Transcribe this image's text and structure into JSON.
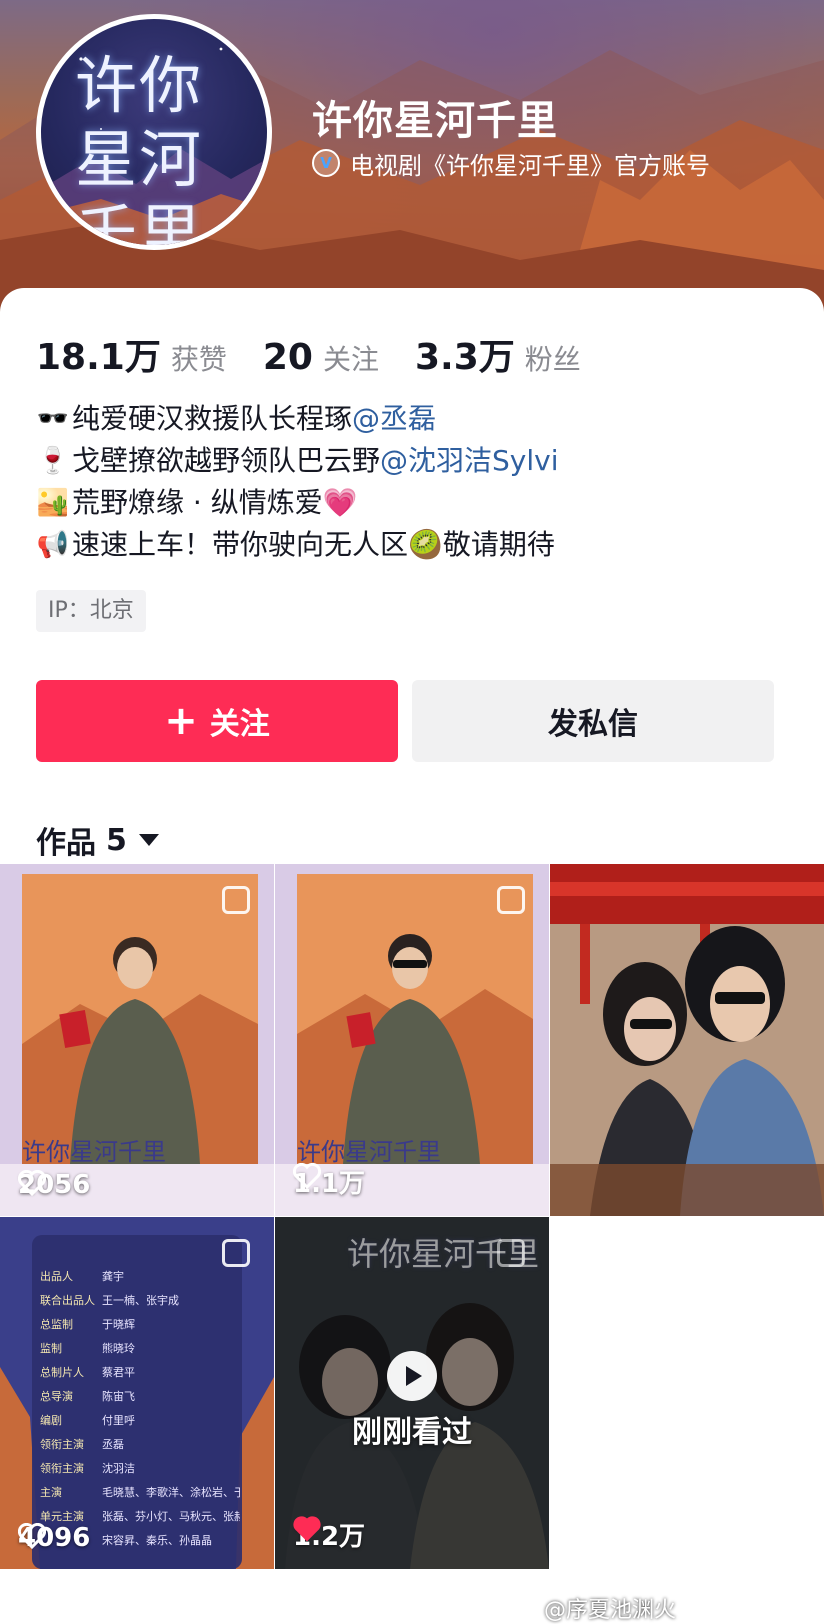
{
  "profile": {
    "name": "许你星河千里",
    "verify_text": "电视剧《许你星河千里》官方账号",
    "avatar_text": "许你星河千里",
    "stats": [
      {
        "num": "18.1万",
        "label": "获赞"
      },
      {
        "num": "20",
        "label": "关注"
      },
      {
        "num": "3.3万",
        "label": "粉丝"
      }
    ],
    "bio": [
      {
        "emoji": "🕶️",
        "text": "纯爱硬汉救援队长程琢",
        "mention": "@丞磊"
      },
      {
        "emoji": "🍷",
        "text": "戈壁撩欲越野领队巴云野",
        "mention": "@沈羽洁Sylvi"
      },
      {
        "emoji": "🏜️",
        "text": "荒野燎缘 · 纵情炼爱",
        "mention": "💗"
      },
      {
        "emoji": "📢",
        "text": "速速上车！带你驶向无人区🥝敬请期待",
        "mention": ""
      }
    ],
    "ip": "IP：北京"
  },
  "actions": {
    "follow_plus": "+",
    "follow_label": "关注",
    "message_label": "发私信"
  },
  "works": {
    "label": "作品",
    "count": "5"
  },
  "grid": [
    {
      "likes": "2056",
      "title": "许你星河千里"
    },
    {
      "likes": "1.1万",
      "title": "许你星河千里"
    },
    {
      "likes": ""
    },
    {
      "likes": "4096",
      "credits": [
        {
          "role": "出品人",
          "name": "龚宇"
        },
        {
          "role": "联合出品人",
          "name": "王一楠、张宇成"
        },
        {
          "role": "总监制",
          "name": "于晓辉"
        },
        {
          "role": "监制",
          "name": "熊晓玲"
        },
        {
          "role": "总制片人",
          "name": "蔡君平"
        },
        {
          "role": "总导演",
          "name": "陈宙飞"
        },
        {
          "role": "编剧",
          "name": "付里呼"
        },
        {
          "role": "领衔主演",
          "name": "丞磊"
        },
        {
          "role": "领衔主演",
          "name": "沈羽洁"
        },
        {
          "role": "主演",
          "name": "毛晓慧、李歌洋、涂松岩、于毅"
        },
        {
          "role": "单元主演",
          "name": "张磊、芬小灯、马秋元、张赫"
        },
        {
          "role": "",
          "name": "宋容昇、秦乐、孙晶晶"
        }
      ]
    },
    {
      "likes": "1.2万",
      "title": "许你星河千里",
      "watched": "刚刚看过"
    }
  ],
  "watermark": "@序夏池渊火",
  "colors": {
    "accent": "#fe2c55",
    "mention": "#2f5f9f",
    "secondary": "#8a8b91"
  }
}
